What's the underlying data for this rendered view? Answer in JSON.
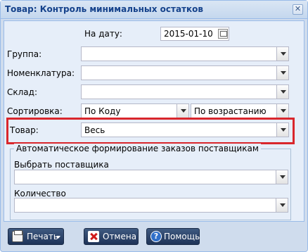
{
  "window": {
    "title": "Товар: Контроль минимальных остатков",
    "close_glyph": "✕"
  },
  "form": {
    "date_label": "На дату:",
    "date_value": "2015-01-10",
    "group_label": "Группа:",
    "group_value": "",
    "nomenclature_label": "Номенклатура:",
    "nomenclature_value": "",
    "warehouse_label": "Склад:",
    "warehouse_value": "",
    "sort_label": "Сортировка:",
    "sort_by_value": "По Коду",
    "sort_order_value": "По возрастанию",
    "product_label": "Товар:",
    "product_value": "Весь"
  },
  "auto_orders": {
    "legend": "Автоматическое формирование заказов поставщикам",
    "supplier_label": "Выбрать поставщика",
    "supplier_value": "",
    "quantity_label": "Количество",
    "quantity_value": ""
  },
  "buttons": {
    "print_label": "Печать",
    "cancel_label": "Отмена",
    "help_label": "Помощь",
    "help_glyph": "?"
  },
  "colors": {
    "highlight": "#d9262c",
    "button_bg": "#1e3358",
    "title_text": "#15428b"
  }
}
